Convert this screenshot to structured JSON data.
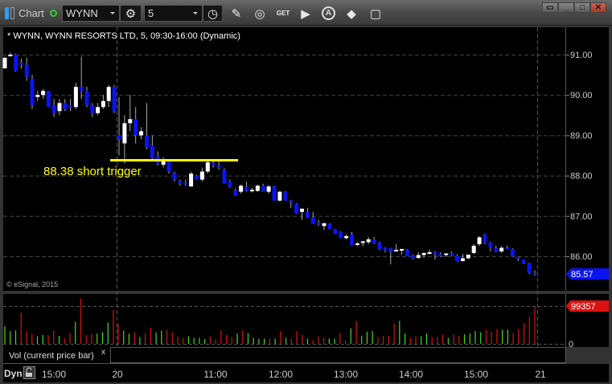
{
  "toolbar": {
    "title": "Chart",
    "symbol": "WYNN",
    "interval": "5",
    "icons": [
      "layout-icon",
      "status-dot-icon",
      "gear-icon",
      "clock-icon",
      "pencil-icon",
      "study-icon",
      "get-icon",
      "play-icon",
      "alert-icon",
      "link-icon",
      "comment-icon"
    ],
    "get_label": "GET",
    "alert_label": "A"
  },
  "window": {
    "icons": [
      "restore-menu-icon",
      "minimize-icon",
      "maximize-icon",
      "close-icon"
    ]
  },
  "chart": {
    "header": "* WYNN, WYNN RESORTS LTD, 5, 09:30-16:00 (Dynamic)",
    "annotation": "88.38 short trigger",
    "copyright": "© eSignal, 2015",
    "last_price": "85.57",
    "vol_last": "99357",
    "vol_zero": "0",
    "vol_legend": "Vol (current price bar)",
    "vol_close": "x",
    "dyn_label": "Dyn",
    "colors": {
      "up": "#ffffff",
      "down": "#0a14f0",
      "trigger": "#ffff00",
      "vol_up": "#44dd22",
      "vol_down": "#dd1111",
      "last_price_bg": "#0a14f0",
      "vol_last_bg": "#dd1111"
    }
  },
  "chart_data": {
    "type": "candlestick",
    "title": "WYNN, WYNN RESORTS LTD, 5-minute",
    "price_ticks": [
      "91.00",
      "90.00",
      "89.00",
      "88.00",
      "87.00",
      "86.00"
    ],
    "price_tick_values": [
      91,
      90,
      89,
      88,
      87,
      86
    ],
    "time_ticks": [
      "15:00",
      "20",
      "11:00",
      "12:00",
      "13:00",
      "14:00",
      "15:00",
      "21"
    ],
    "trigger_level": 88.38,
    "day1_ohlc": [
      [
        90.66,
        90.95,
        90.66,
        90.92
      ],
      [
        90.98,
        91.05,
        90.95,
        91.0
      ],
      [
        91.0,
        91.02,
        90.58,
        90.6
      ],
      [
        90.8,
        90.9,
        90.65,
        90.75
      ],
      [
        90.75,
        90.92,
        90.35,
        90.45
      ],
      [
        90.4,
        90.5,
        89.65,
        89.75
      ],
      [
        89.95,
        90.1,
        89.85,
        90.0
      ],
      [
        90.0,
        90.15,
        89.9,
        90.1
      ],
      [
        90.1,
        90.1,
        89.7,
        89.7
      ],
      [
        89.75,
        89.9,
        89.45,
        89.55
      ],
      [
        89.6,
        89.9,
        89.5,
        89.8
      ],
      [
        89.8,
        89.9,
        89.6,
        89.65
      ],
      [
        89.75,
        89.9,
        89.6,
        89.7
      ],
      [
        89.7,
        90.3,
        89.65,
        90.2
      ],
      [
        90.2,
        90.95,
        89.9,
        90.1
      ],
      [
        90.1,
        90.2,
        89.7,
        89.75
      ],
      [
        89.75,
        89.8,
        89.45,
        89.55
      ],
      [
        89.55,
        89.8,
        89.5,
        89.7
      ],
      [
        89.7,
        90.0,
        89.65,
        89.85
      ],
      [
        89.85,
        90.25,
        89.7,
        90.2
      ],
      [
        90.2,
        90.25,
        89.55,
        89.6
      ]
    ],
    "day2_ohlc": [
      [
        89.0,
        89.95,
        88.5,
        88.9
      ],
      [
        88.8,
        89.5,
        88.3,
        89.3
      ],
      [
        89.3,
        90.0,
        89.1,
        89.4
      ],
      [
        89.4,
        89.7,
        88.8,
        89.0
      ],
      [
        89.0,
        89.2,
        88.9,
        89.1
      ],
      [
        89.0,
        89.8,
        88.65,
        88.7
      ],
      [
        88.75,
        89.0,
        88.4,
        88.43
      ],
      [
        88.47,
        88.6,
        88.25,
        88.3
      ],
      [
        88.27,
        88.45,
        88.2,
        88.4
      ],
      [
        88.37,
        88.37,
        88.05,
        88.1
      ],
      [
        88.07,
        88.1,
        87.85,
        87.9
      ],
      [
        87.85,
        87.9,
        87.75,
        87.8
      ],
      [
        87.82,
        87.9,
        87.75,
        87.78
      ],
      [
        87.73,
        88.1,
        87.73,
        88.05
      ],
      [
        88.0,
        88.02,
        87.9,
        87.9
      ],
      [
        87.9,
        88.2,
        87.85,
        88.1
      ],
      [
        88.1,
        88.35,
        88.05,
        88.33
      ],
      [
        88.3,
        88.35,
        88.2,
        88.25
      ],
      [
        88.25,
        88.4,
        88.15,
        88.2
      ],
      [
        88.15,
        88.18,
        87.8,
        87.8
      ],
      [
        87.85,
        87.9,
        87.7,
        87.72
      ],
      [
        87.63,
        87.68,
        87.5,
        87.5
      ],
      [
        87.6,
        87.78,
        87.55,
        87.75
      ],
      [
        87.72,
        87.85,
        87.6,
        87.62
      ],
      [
        87.62,
        87.7,
        87.58,
        87.65
      ],
      [
        87.62,
        87.78,
        87.6,
        87.75
      ],
      [
        87.75,
        87.8,
        87.6,
        87.6
      ],
      [
        87.6,
        87.77,
        87.55,
        87.73
      ],
      [
        87.73,
        87.75,
        87.38,
        87.38
      ],
      [
        87.38,
        87.62,
        87.36,
        87.6
      ],
      [
        87.6,
        87.62,
        87.38,
        87.38
      ],
      [
        87.38,
        87.4,
        87.2,
        87.33
      ],
      [
        87.3,
        87.32,
        87.05,
        87.06
      ],
      [
        87.1,
        87.18,
        86.9,
        87.18
      ],
      [
        87.1,
        87.2,
        86.95,
        86.95
      ],
      [
        86.96,
        87.1,
        86.8,
        86.8
      ],
      [
        86.83,
        86.9,
        86.75,
        86.79
      ],
      [
        86.75,
        86.82,
        86.65,
        86.82
      ],
      [
        86.8,
        86.82,
        86.67,
        86.67
      ],
      [
        86.67,
        86.68,
        86.55,
        86.55
      ],
      [
        86.6,
        86.62,
        86.45,
        86.45
      ],
      [
        86.45,
        86.55,
        86.42,
        86.5
      ],
      [
        86.54,
        86.6,
        86.27,
        86.28
      ],
      [
        86.29,
        86.35,
        86.25,
        86.32
      ],
      [
        86.33,
        86.38,
        86.25,
        86.37
      ],
      [
        86.35,
        86.48,
        86.3,
        86.42
      ],
      [
        86.42,
        86.48,
        86.3,
        86.32
      ],
      [
        86.34,
        86.36,
        86.15,
        86.16
      ],
      [
        86.2,
        86.22,
        86.1,
        86.15
      ],
      [
        86.2,
        86.21,
        85.8,
        86.11
      ],
      [
        86.13,
        86.3,
        86.12,
        86.16
      ],
      [
        86.16,
        86.18,
        86.04,
        86.18
      ],
      [
        86.16,
        86.18,
        86.0,
        86.0
      ],
      [
        86.03,
        86.05,
        85.92,
        85.95
      ],
      [
        85.96,
        86.1,
        85.93,
        86.03
      ],
      [
        86.03,
        86.1,
        85.96,
        86.08
      ],
      [
        86.07,
        86.17,
        86.05,
        86.1
      ],
      [
        86.11,
        86.13,
        85.92,
        86.05
      ],
      [
        86.05,
        86.1,
        85.98,
        86.0
      ],
      [
        86.03,
        86.07,
        85.98,
        86.07
      ],
      [
        86.08,
        86.12,
        86.0,
        86.03
      ],
      [
        86.02,
        86.05,
        85.87,
        85.88
      ],
      [
        85.88,
        86.06,
        85.87,
        85.95
      ],
      [
        85.95,
        86.02,
        85.93,
        86.04
      ],
      [
        86.08,
        86.3,
        86.05,
        86.26
      ],
      [
        86.3,
        86.5,
        86.25,
        86.47
      ],
      [
        86.54,
        86.56,
        86.3,
        86.34
      ],
      [
        86.34,
        86.36,
        86.12,
        86.23
      ],
      [
        86.2,
        86.27,
        86.1,
        86.11
      ],
      [
        86.12,
        86.25,
        86.08,
        86.21
      ],
      [
        86.21,
        86.26,
        86.18,
        86.18
      ],
      [
        86.18,
        86.2,
        86.0,
        86.0
      ],
      [
        85.98,
        85.99,
        85.88,
        85.93
      ],
      [
        85.91,
        85.92,
        85.8,
        85.83
      ],
      [
        85.83,
        85.84,
        85.56,
        85.59
      ],
      [
        85.59,
        85.65,
        85.52,
        85.57
      ]
    ],
    "volume_max": 99357,
    "day1_volume": [
      [
        46150,
        "g"
      ],
      [
        33370,
        "g"
      ],
      [
        35500,
        "g"
      ],
      [
        81650,
        "r"
      ],
      [
        33370,
        "r"
      ],
      [
        26270,
        "r"
      ],
      [
        19880,
        "g"
      ],
      [
        23430,
        "g"
      ],
      [
        22720,
        "r"
      ],
      [
        34790,
        "r"
      ],
      [
        21300,
        "g"
      ],
      [
        14200,
        "r"
      ],
      [
        28400,
        "r"
      ],
      [
        58220,
        "g"
      ],
      [
        122120,
        "r"
      ],
      [
        23430,
        "r"
      ],
      [
        26270,
        "r"
      ],
      [
        26980,
        "g"
      ],
      [
        30530,
        "g"
      ],
      [
        56090,
        "g"
      ],
      [
        90170,
        "r"
      ]
    ],
    "day2_volume": [
      [
        51830,
        "r"
      ],
      [
        34790,
        "g"
      ],
      [
        26980,
        "g"
      ],
      [
        30530,
        "r"
      ],
      [
        17750,
        "g"
      ],
      [
        28400,
        "r"
      ],
      [
        42600,
        "r"
      ],
      [
        29820,
        "g"
      ],
      [
        34790,
        "g"
      ],
      [
        36920,
        "r"
      ],
      [
        30530,
        "r"
      ],
      [
        19170,
        "r"
      ],
      [
        15620,
        "r"
      ],
      [
        19880,
        "g"
      ],
      [
        15620,
        "g"
      ],
      [
        15620,
        "g"
      ],
      [
        12780,
        "g"
      ],
      [
        19170,
        "r"
      ],
      [
        12070,
        "r"
      ],
      [
        35500,
        "r"
      ],
      [
        23430,
        "r"
      ],
      [
        17750,
        "r"
      ],
      [
        26980,
        "g"
      ],
      [
        35500,
        "r"
      ],
      [
        28400,
        "g"
      ],
      [
        15620,
        "g"
      ],
      [
        13490,
        "g"
      ],
      [
        13490,
        "g"
      ],
      [
        13490,
        "r"
      ],
      [
        13490,
        "g"
      ],
      [
        33370,
        "r"
      ],
      [
        15620,
        "g"
      ],
      [
        13490,
        "r"
      ],
      [
        33370,
        "r"
      ],
      [
        23430,
        "r"
      ],
      [
        13490,
        "g"
      ],
      [
        9230,
        "r"
      ],
      [
        19170,
        "r"
      ],
      [
        15620,
        "r"
      ],
      [
        13490,
        "g"
      ],
      [
        13490,
        "g"
      ],
      [
        28400,
        "r"
      ],
      [
        9230,
        "r"
      ],
      [
        41180,
        "g"
      ],
      [
        60350,
        "r"
      ],
      [
        21300,
        "g"
      ],
      [
        31950,
        "g"
      ],
      [
        33370,
        "g"
      ],
      [
        17750,
        "r"
      ],
      [
        21300,
        "r"
      ],
      [
        21300,
        "r"
      ],
      [
        53250,
        "r"
      ],
      [
        60350,
        "g"
      ],
      [
        26980,
        "g"
      ],
      [
        15620,
        "r"
      ],
      [
        21300,
        "r"
      ],
      [
        19880,
        "g"
      ],
      [
        26980,
        "g"
      ],
      [
        17750,
        "r"
      ],
      [
        17750,
        "r"
      ],
      [
        24850,
        "r"
      ],
      [
        15620,
        "g"
      ],
      [
        24850,
        "r"
      ],
      [
        21300,
        "r"
      ],
      [
        24850,
        "g"
      ],
      [
        26980,
        "g"
      ],
      [
        33370,
        "g"
      ],
      [
        30530,
        "g"
      ],
      [
        36920,
        "r"
      ],
      [
        31950,
        "r"
      ],
      [
        39050,
        "r"
      ],
      [
        36920,
        "g"
      ],
      [
        36920,
        "g"
      ],
      [
        28400,
        "r"
      ],
      [
        39050,
        "r"
      ],
      [
        54670,
        "r"
      ],
      [
        71710,
        "r"
      ],
      [
        99357,
        "r"
      ]
    ]
  }
}
